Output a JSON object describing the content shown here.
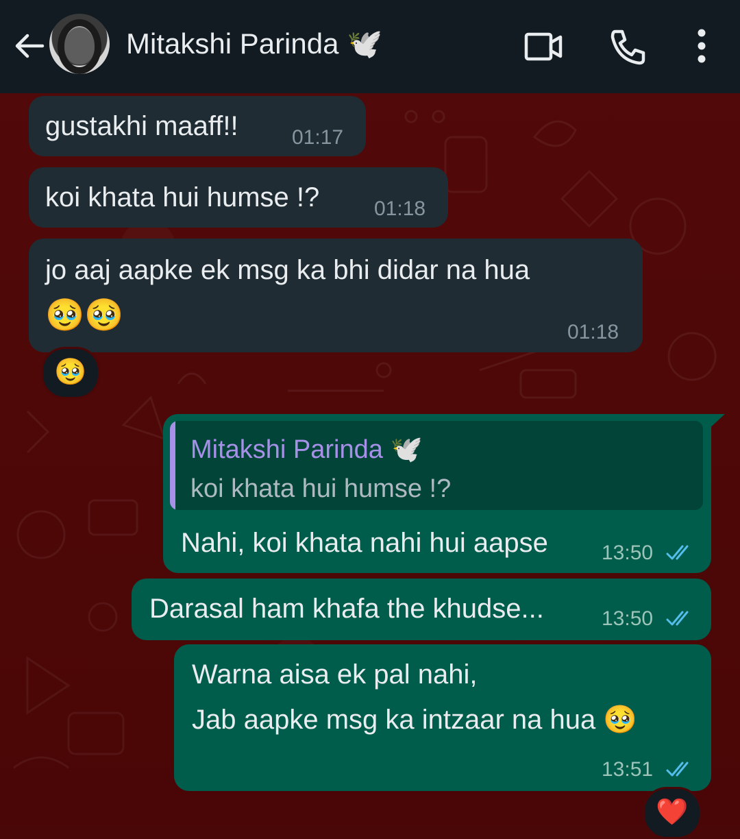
{
  "header": {
    "contact_name": "Mitakshi Parinda 🕊️"
  },
  "messages": [
    {
      "direction": "in",
      "text": "gustakhi maaff!!",
      "time": "01:17"
    },
    {
      "direction": "in",
      "text": "koi khata hui humse !?",
      "time": "01:18"
    },
    {
      "direction": "in",
      "text_line1": "jo aaj aapke ek msg ka bhi didar na hua",
      "text_line2": "🥹🥹",
      "time": "01:18",
      "reaction": "🥹"
    },
    {
      "direction": "out",
      "reply_name": "Mitakshi Parinda 🕊️",
      "reply_text": "koi khata hui humse !?",
      "text": "Nahi, koi khata nahi hui aapse",
      "time": "13:50",
      "status": "read"
    },
    {
      "direction": "out",
      "text": "Darasal ham khafa the khudse...",
      "time": "13:50",
      "status": "read"
    },
    {
      "direction": "out",
      "text_line1": "Warna aisa ek pal nahi,",
      "text_line2": "Jab aapke msg ka intzaar na hua 🥹",
      "time": "13:51",
      "status": "read",
      "reaction": "❤️"
    }
  ],
  "colors": {
    "header_bg": "#111b21",
    "incoming_bubble": "#202c33",
    "outgoing_bubble": "#005c4b",
    "wallpaper": "#4a0707",
    "read_ticks": "#53bdeb",
    "reply_accent": "#a791e8"
  },
  "icons": [
    "back-arrow-icon",
    "video-call-icon",
    "phone-icon",
    "more-options-icon",
    "double-check-icon"
  ]
}
